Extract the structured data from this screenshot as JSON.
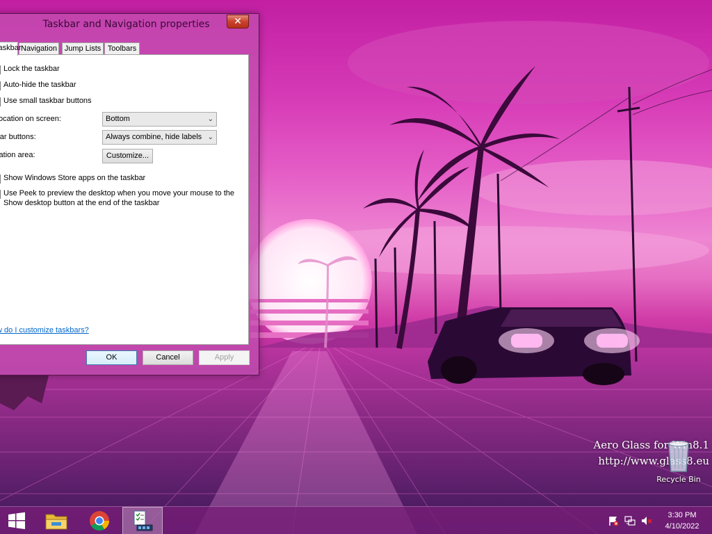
{
  "desktop": {
    "watermark_line1": "Aero Glass for Win8.1",
    "watermark_line2": "http://www.glass8.eu",
    "recycle_bin_label": "Recycle Bin"
  },
  "dialog": {
    "title": "Taskbar and Navigation properties",
    "close_glyph": "✕",
    "tabs": {
      "taskbar": "Taskbar",
      "navigation": "Navigation",
      "jump_lists": "Jump Lists",
      "toolbars": "Toolbars"
    },
    "checkboxes": {
      "lock": "Lock the taskbar",
      "autohide": "Auto-hide the taskbar",
      "small_buttons": "Use small taskbar buttons",
      "store_apps": "Show Windows Store apps on the taskbar",
      "peek_line1": "Use Peek to preview the desktop when you move your mouse to the",
      "peek_line2": "Show desktop button at the end of the taskbar"
    },
    "location_label": "Taskbar location on screen:",
    "location_value": "Bottom",
    "buttons_label": "Taskbar buttons:",
    "buttons_value": "Always combine, hide labels",
    "notification_label": "Notification area:",
    "customize_label": "Customize...",
    "help_link": "How do I customize taskbars?",
    "ok_label": "OK",
    "cancel_label": "Cancel",
    "apply_label": "Apply"
  },
  "taskbar": {
    "icons": [
      "windows-start-icon",
      "file-explorer-icon",
      "chrome-icon",
      "taskbar-properties-icon"
    ],
    "tray_icons": [
      "action-center-flag-icon",
      "network-icon",
      "volume-muted-icon"
    ],
    "clock_time": "3:30 PM",
    "clock_date": "4/10/2022"
  },
  "colors": {
    "sky_top": "#c21fa3",
    "horizon": "#ee86d2",
    "road": "#7a1a8a",
    "taillight": "#ff8fe8",
    "link": "#0066cc"
  }
}
